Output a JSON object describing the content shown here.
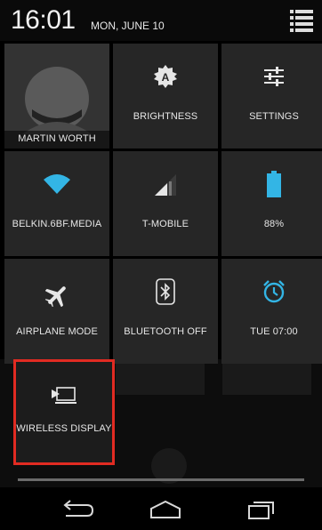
{
  "status_bar": {
    "time": "16:01",
    "date": "MON, JUNE 10",
    "menu_icon": "settings-list-icon"
  },
  "tiles": {
    "user": {
      "label": "MARTIN WORTH",
      "icon": "avatar-icon"
    },
    "brightness": {
      "label": "BRIGHTNESS",
      "icon": "brightness-auto-icon"
    },
    "settings": {
      "label": "SETTINGS",
      "icon": "sliders-icon"
    },
    "wifi": {
      "label": "BELKIN.6BF.MEDIA",
      "icon": "wifi-icon"
    },
    "mobile": {
      "label": "T-MOBILE",
      "icon": "signal-icon"
    },
    "battery": {
      "label": "88%",
      "level": 0.88,
      "icon": "battery-icon"
    },
    "airplane": {
      "label": "AIRPLANE MODE",
      "icon": "airplane-icon"
    },
    "bluetooth": {
      "label": "BLUETOOTH OFF",
      "icon": "bluetooth-icon"
    },
    "alarm": {
      "label": "TUE 07:00",
      "icon": "alarm-icon"
    },
    "wireless_display": {
      "label": "WIRELESS DISPLAY",
      "icon": "cast-screen-icon"
    }
  },
  "colors": {
    "accent": "#33b5e5",
    "tile_bg": "#262626",
    "highlight": "#e12b22"
  },
  "nav": {
    "back_icon": "back-icon",
    "home_icon": "home-icon",
    "recents_icon": "recents-icon"
  }
}
